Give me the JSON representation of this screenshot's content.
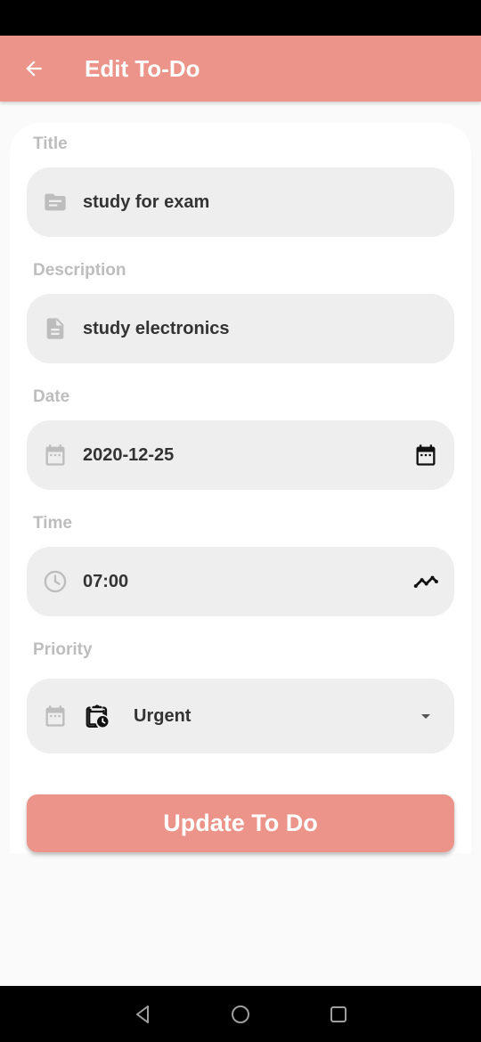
{
  "app_bar": {
    "title": "Edit To-Do",
    "back_icon": "arrow-back-icon",
    "color": "#ec9489"
  },
  "form": {
    "title": {
      "label": "Title",
      "value": "study for exam",
      "icon": "folder-icon"
    },
    "description": {
      "label": "Description",
      "value": "study electronics",
      "icon": "document-icon"
    },
    "date": {
      "label": "Date",
      "value": "2020-12-25",
      "icon": "calendar-icon",
      "action_icon": "calendar-picker-icon"
    },
    "time": {
      "label": "Time",
      "value": "07:00",
      "icon": "clock-icon",
      "action_icon": "trend-icon"
    },
    "priority": {
      "label": "Priority",
      "value": "Urgent",
      "icon": "calendar-icon",
      "value_icon": "clipboard-clock-icon",
      "action_icon": "dropdown-arrow-icon"
    }
  },
  "update_button": {
    "label": "Update To Do"
  },
  "nav_bar": {
    "back": "nav-back-icon",
    "home": "nav-home-icon",
    "recents": "nav-recents-icon"
  },
  "colors": {
    "accent": "#ec9489",
    "field_bg": "#eeeeee",
    "label": "#bdbdbd"
  }
}
